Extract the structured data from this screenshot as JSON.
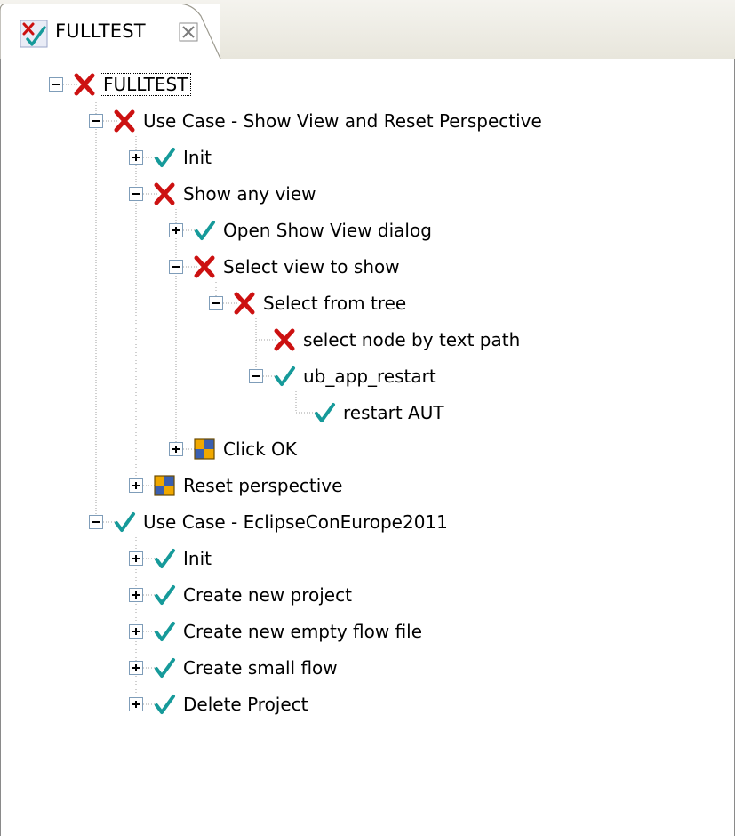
{
  "tab": {
    "title": "FULLTEST",
    "icon": "test-result-icon"
  },
  "tree": [
    {
      "label": "FULLTEST",
      "status": "failed",
      "depth": 0,
      "expander": "minus",
      "focused": true
    },
    {
      "label": "Use Case - Show View and Reset Perspective",
      "status": "failed",
      "depth": 1,
      "expander": "minus"
    },
    {
      "label": "Init",
      "status": "passed",
      "depth": 2,
      "expander": "plus"
    },
    {
      "label": "Show any view",
      "status": "failed",
      "depth": 2,
      "expander": "minus"
    },
    {
      "label": "Open Show View dialog",
      "status": "passed",
      "depth": 3,
      "expander": "plus"
    },
    {
      "label": "Select view to show",
      "status": "failed",
      "depth": 3,
      "expander": "minus"
    },
    {
      "label": "Select from tree",
      "status": "failed",
      "depth": 4,
      "expander": "minus"
    },
    {
      "label": "select node by text path",
      "status": "failed",
      "depth": 5,
      "expander": "none"
    },
    {
      "label": "ub_app_restart",
      "status": "passed",
      "depth": 5,
      "expander": "minus"
    },
    {
      "label": "restart AUT",
      "status": "passed",
      "depth": 6,
      "expander": "none"
    },
    {
      "label": "Click OK",
      "status": "not-run",
      "depth": 3,
      "expander": "plus"
    },
    {
      "label": "Reset perspective",
      "status": "not-run",
      "depth": 2,
      "expander": "plus"
    },
    {
      "label": "Use Case - EclipseConEurope2011",
      "status": "passed",
      "depth": 1,
      "expander": "minus"
    },
    {
      "label": "Init",
      "status": "passed",
      "depth": 2,
      "expander": "plus"
    },
    {
      "label": "Create new project",
      "status": "passed",
      "depth": 2,
      "expander": "plus"
    },
    {
      "label": "Create new empty flow file",
      "status": "passed",
      "depth": 2,
      "expander": "plus"
    },
    {
      "label": "Create small flow",
      "status": "passed",
      "depth": 2,
      "expander": "plus"
    },
    {
      "label": "Delete Project",
      "status": "passed",
      "depth": 2,
      "expander": "plus"
    }
  ],
  "colors": {
    "failed": "#cc1111",
    "passed": "#169a9a",
    "not-run-a": "#f0a800",
    "not-run-b": "#3a5fb0"
  }
}
